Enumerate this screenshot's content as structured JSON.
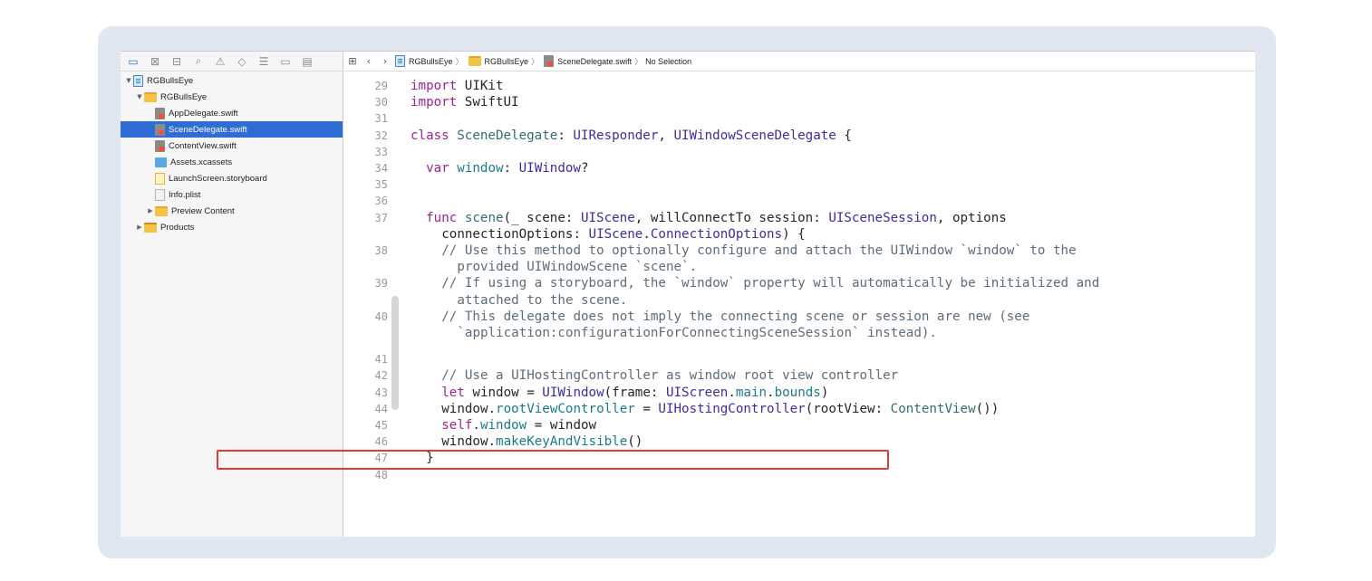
{
  "navigator": {
    "icons": [
      "folder-icon",
      "xmark-box-icon",
      "hierarchy-icon",
      "search-icon",
      "warning-icon",
      "diamond-icon",
      "list-icon",
      "tag-icon",
      "chat-icon"
    ],
    "tree": [
      {
        "label": "RGBullsEye",
        "icon": "project",
        "depth": 0,
        "disclosure": "▼"
      },
      {
        "label": "RGBullsEye",
        "icon": "folder",
        "depth": 1,
        "disclosure": "▼"
      },
      {
        "label": "AppDelegate.swift",
        "icon": "swift",
        "depth": 2,
        "disclosure": ""
      },
      {
        "label": "SceneDelegate.swift",
        "icon": "swift",
        "depth": 2,
        "disclosure": "",
        "selected": true
      },
      {
        "label": "ContentView.swift",
        "icon": "swift",
        "depth": 2,
        "disclosure": ""
      },
      {
        "label": "Assets.xcassets",
        "icon": "assets",
        "depth": 2,
        "disclosure": ""
      },
      {
        "label": "LaunchScreen.storyboard",
        "icon": "storyboard",
        "depth": 2,
        "disclosure": ""
      },
      {
        "label": "Info.plist",
        "icon": "plist",
        "depth": 2,
        "disclosure": ""
      },
      {
        "label": "Preview Content",
        "icon": "folder",
        "depth": 2,
        "disclosure": "▶"
      },
      {
        "label": "Products",
        "icon": "products",
        "depth": 1,
        "disclosure": "▶"
      }
    ]
  },
  "jumpbar": {
    "grid_icon": "⊞",
    "back": "‹",
    "forward": "›",
    "crumbs": [
      "RGBullsEye",
      "RGBullsEye",
      "SceneDelegate.swift",
      "No Selection"
    ],
    "separator": "〉"
  },
  "code": [
    {
      "ln": "29",
      "row": 0,
      "indent": 0,
      "tokens": [
        [
          "kw",
          "import"
        ],
        [
          "",
          " UIKit"
        ]
      ]
    },
    {
      "ln": "30",
      "row": 1,
      "indent": 0,
      "tokens": [
        [
          "kw",
          "import"
        ],
        [
          "",
          " SwiftUI"
        ]
      ]
    },
    {
      "ln": "31",
      "row": 2,
      "indent": 0,
      "tokens": []
    },
    {
      "ln": "32",
      "row": 3,
      "indent": 0,
      "tokens": [
        [
          "kw",
          "class"
        ],
        [
          "",
          " "
        ],
        [
          "fn",
          "SceneDelegate"
        ],
        [
          "",
          ": "
        ],
        [
          "ty",
          "UIResponder"
        ],
        [
          "",
          ", "
        ],
        [
          "ty",
          "UIWindowSceneDelegate"
        ],
        [
          "",
          " {"
        ]
      ]
    },
    {
      "ln": "33",
      "row": 4,
      "indent": 0,
      "tokens": []
    },
    {
      "ln": "34",
      "row": 5,
      "indent": 2,
      "tokens": [
        [
          "kw",
          "var"
        ],
        [
          "",
          " "
        ],
        [
          "prop",
          "window"
        ],
        [
          "",
          ": "
        ],
        [
          "ty",
          "UIWindow"
        ],
        [
          "",
          "?"
        ]
      ]
    },
    {
      "ln": "35",
      "row": 6,
      "indent": 0,
      "tokens": []
    },
    {
      "ln": "36",
      "row": 7,
      "indent": 0,
      "tokens": []
    },
    {
      "ln": "37",
      "row": 8,
      "indent": 2,
      "tokens": [
        [
          "kw",
          "func"
        ],
        [
          "",
          " "
        ],
        [
          "fn",
          "scene"
        ],
        [
          "",
          "(_ scene: "
        ],
        [
          "ty",
          "UIScene"
        ],
        [
          "",
          ", willConnectTo session: "
        ],
        [
          "ty",
          "UISceneSession"
        ],
        [
          "",
          ", options"
        ]
      ]
    },
    {
      "ln": "",
      "row": 9,
      "indent": 4,
      "tokens": [
        [
          "",
          "connectionOptions: "
        ],
        [
          "ty",
          "UIScene"
        ],
        [
          "",
          "."
        ],
        [
          "ty",
          "ConnectionOptions"
        ],
        [
          "",
          ") {"
        ]
      ]
    },
    {
      "ln": "38",
      "row": 10,
      "indent": 4,
      "tokens": [
        [
          "cm",
          "// Use this method to optionally configure and attach the UIWindow `window` to the"
        ]
      ]
    },
    {
      "ln": "",
      "row": 11,
      "indent": 6,
      "tokens": [
        [
          "cm",
          "provided UIWindowScene `scene`."
        ]
      ]
    },
    {
      "ln": "39",
      "row": 12,
      "indent": 4,
      "tokens": [
        [
          "cm",
          "// If using a storyboard, the `window` property will automatically be initialized and"
        ]
      ]
    },
    {
      "ln": "",
      "row": 13,
      "indent": 6,
      "tokens": [
        [
          "cm",
          "attached to the scene."
        ]
      ]
    },
    {
      "ln": "40",
      "row": 14,
      "indent": 4,
      "tokens": [
        [
          "cm",
          "// This delegate does not imply the connecting scene or session are new (see"
        ]
      ]
    },
    {
      "ln": "",
      "row": 15,
      "indent": 6,
      "tokens": [
        [
          "cm",
          "`application:configurationForConnectingSceneSession` instead)."
        ]
      ]
    },
    {
      "ln": "41",
      "row": 16.6,
      "indent": 0,
      "tokens": []
    },
    {
      "ln": "42",
      "row": 17.6,
      "indent": 4,
      "tokens": [
        [
          "cm",
          "// Use a UIHostingController as window root view controller"
        ]
      ]
    },
    {
      "ln": "43",
      "row": 18.6,
      "indent": 4,
      "tokens": [
        [
          "kw",
          "let"
        ],
        [
          "",
          " window = "
        ],
        [
          "ty",
          "UIWindow"
        ],
        [
          "",
          "(frame: "
        ],
        [
          "ty",
          "UIScreen"
        ],
        [
          "",
          "."
        ],
        [
          "prop",
          "main"
        ],
        [
          "",
          "."
        ],
        [
          "prop",
          "bounds"
        ],
        [
          "",
          ")"
        ]
      ]
    },
    {
      "ln": "44",
      "row": 19.6,
      "indent": 4,
      "tokens": [
        [
          "",
          "window."
        ],
        [
          "prop",
          "rootViewController"
        ],
        [
          "",
          " = "
        ],
        [
          "ty",
          "UIHostingController"
        ],
        [
          "",
          "(rootView: "
        ],
        [
          "fn",
          "ContentView"
        ],
        [
          "",
          "())"
        ]
      ]
    },
    {
      "ln": "45",
      "row": 20.6,
      "indent": 4,
      "tokens": [
        [
          "kw",
          "self"
        ],
        [
          "",
          "."
        ],
        [
          "prop",
          "window"
        ],
        [
          "",
          " = window"
        ]
      ]
    },
    {
      "ln": "46",
      "row": 21.6,
      "indent": 4,
      "tokens": [
        [
          "",
          "window."
        ],
        [
          "prop",
          "makeKeyAndVisible"
        ],
        [
          "",
          "()"
        ]
      ]
    },
    {
      "ln": "47",
      "row": 22.6,
      "indent": 2,
      "tokens": [
        [
          "",
          "}"
        ]
      ]
    },
    {
      "ln": "48",
      "row": 23.6,
      "indent": 0,
      "tokens": []
    }
  ]
}
